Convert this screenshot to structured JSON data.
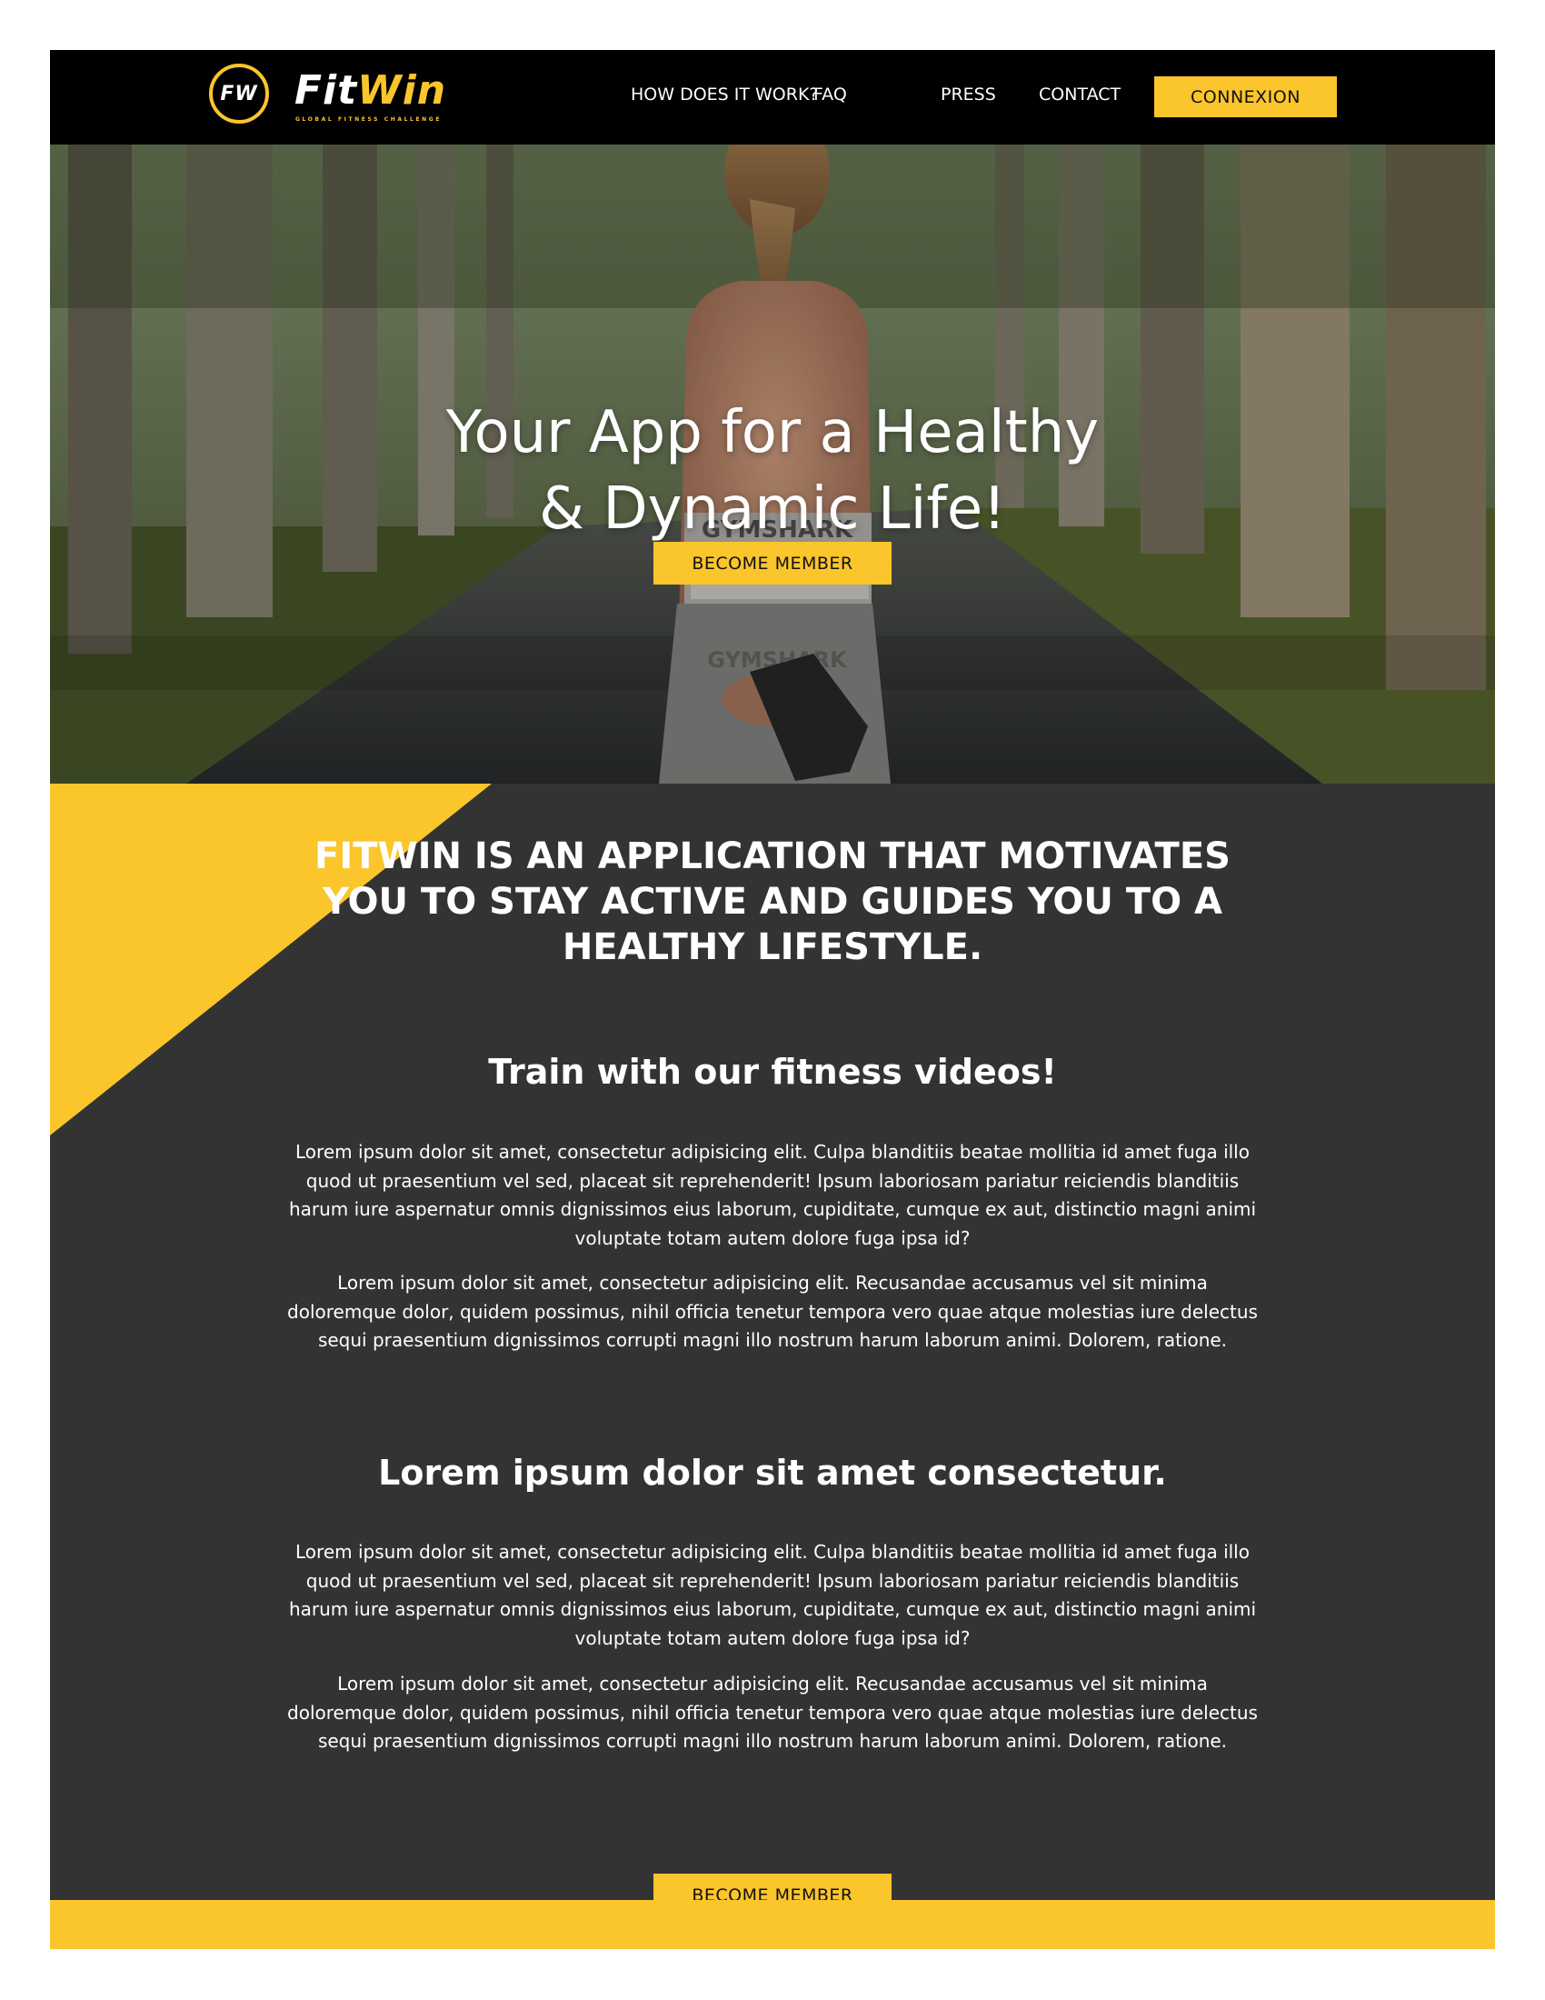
{
  "brand": {
    "badge": "FW",
    "name_part1": "Fit",
    "name_part2": "Win",
    "tagline": "GLOBAL FITNESS CHALLENGE"
  },
  "nav": {
    "items": [
      {
        "label": "HOW DOES IT WORK?"
      },
      {
        "label": "FAQ"
      },
      {
        "label": "PRESS"
      },
      {
        "label": "CONTACT"
      }
    ],
    "login_label": "CONNEXION"
  },
  "hero": {
    "title_line1": "Your App for a Healthy",
    "title_line2": "& Dynamic Life!",
    "cta_label": "BECOME MEMBER",
    "shirt_text": "GYMSHARK"
  },
  "content": {
    "intro": "FITWIN IS AN APPLICATION THAT MOTIVATES YOU TO STAY ACTIVE AND GUIDES YOU TO A HEALTHY LIFESTYLE.",
    "section1": {
      "heading": "Train with our fitness videos!",
      "paragraphs": [
        "Lorem ipsum dolor sit amet, consectetur adipisicing elit. Culpa blanditiis beatae mollitia id amet fuga illo quod ut praesentium vel sed, placeat sit reprehenderit! Ipsum laboriosam pariatur reiciendis blanditiis harum iure aspernatur omnis dignissimos eius laborum, cupiditate, cumque ex aut, distinctio magni animi voluptate totam autem dolore fuga ipsa id?",
        "Lorem ipsum dolor sit amet, consectetur adipisicing elit. Recusandae accusamus vel sit minima doloremque dolor, quidem possimus, nihil officia tenetur tempora vero quae atque molestias iure delectus sequi praesentium dignissimos corrupti magni illo nostrum harum laborum animi. Dolorem, ratione."
      ]
    },
    "section2": {
      "heading": "Lorem ipsum dolor sit amet consectetur.",
      "paragraphs": [
        "Lorem ipsum dolor sit amet, consectetur adipisicing elit. Culpa blanditiis beatae mollitia id amet fuga illo quod ut praesentium vel sed, placeat sit reprehenderit! Ipsum laboriosam pariatur reiciendis blanditiis harum iure aspernatur omnis dignissimos eius laborum, cupiditate, cumque ex aut, distinctio magni animi voluptate totam autem dolore fuga ipsa id?",
        "Lorem ipsum dolor sit amet, consectetur adipisicing elit. Recusandae accusamus vel sit minima doloremque dolor, quidem possimus, nihil officia tenetur tempora vero quae atque molestias iure delectus sequi praesentium dignissimos corrupti magni illo nostrum harum laborum animi. Dolorem, ratione."
      ]
    },
    "cta_label": "BECOME MEMBER"
  },
  "colors": {
    "accent": "#fbc52c",
    "dark_section": "#333333",
    "header": "#000000"
  }
}
